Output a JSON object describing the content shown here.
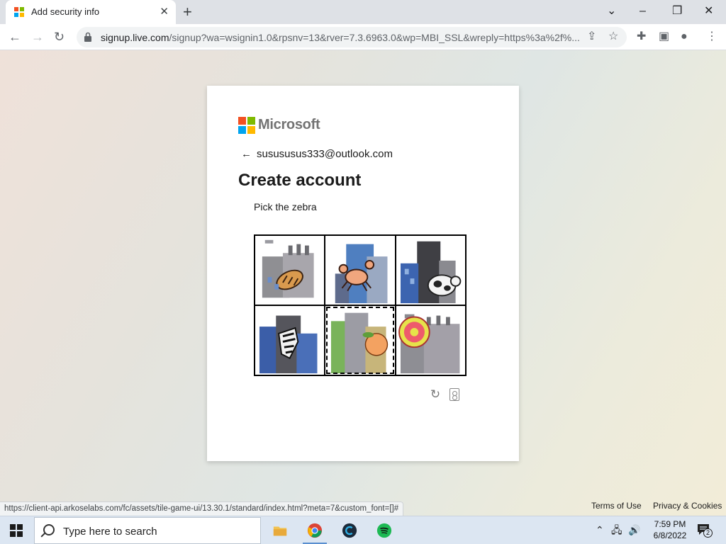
{
  "browser": {
    "tab_title": "Add security info",
    "url_host": "signup.live.com",
    "url_rest": "/signup?wa=wsignin1.0&rpsnv=13&rver=7.3.6963.0&wp=MBI_SSL&wreply=https%3a%2f%...",
    "status_url": "https://client-api.arkoselabs.com/fc/assets/tile-game-ui/13.30.1/standard/index.html?meta=7&custom_font=[]#"
  },
  "card": {
    "brand": "Microsoft",
    "identity": "susususus333@outlook.com",
    "heading": "Create account",
    "prompt": "Pick the zebra",
    "tiles": [
      {
        "subject": "bread"
      },
      {
        "subject": "crab"
      },
      {
        "subject": "cow"
      },
      {
        "subject": "zebra"
      },
      {
        "subject": "peach",
        "selected": true
      },
      {
        "subject": "donut"
      }
    ]
  },
  "footer": {
    "terms": "Terms of Use",
    "privacy": "Privacy & Cookies"
  },
  "taskbar": {
    "search_placeholder": "Type here to search",
    "time": "7:59 PM",
    "date": "6/8/2022",
    "notifications": "2"
  },
  "colors": {
    "ms_red": "#f25022",
    "ms_green": "#7fba00",
    "ms_blue": "#00a4ef",
    "ms_yellow": "#ffb900"
  }
}
